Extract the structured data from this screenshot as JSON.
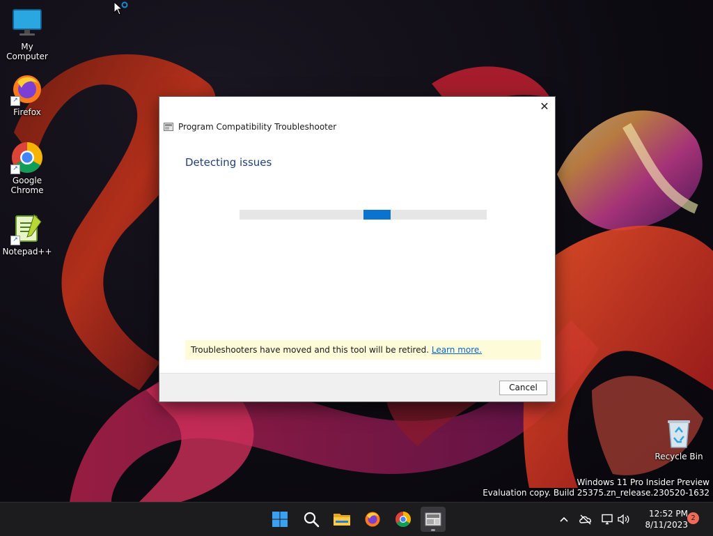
{
  "desktop": {
    "icons": [
      {
        "label": "My Computer",
        "icon": "monitor-icon"
      },
      {
        "label": "Firefox",
        "icon": "firefox-icon"
      },
      {
        "label": "Google Chrome",
        "icon": "chrome-icon"
      },
      {
        "label": "Notepad++",
        "icon": "notepadpp-icon"
      },
      {
        "label": "Recycle Bin",
        "icon": "recycle-bin-icon"
      }
    ],
    "watermark_line1": "Windows 11 Pro Insider Preview",
    "watermark_line2": "Evaluation copy. Build 25375.zn_release.230520-1632"
  },
  "dialog": {
    "title": "Program Compatibility Troubleshooter",
    "heading": "Detecting issues",
    "progress_state": "indeterminate",
    "notice_text": "Troubleshooters have moved and this tool will be retired.",
    "notice_link": "Learn more.",
    "cancel_label": "Cancel",
    "close_glyph": "✕",
    "notice_color": "#fefbd8",
    "accent_color": "#0a73d0"
  },
  "taskbar": {
    "pinned": [
      {
        "name": "start",
        "icon": "windows-start-icon"
      },
      {
        "name": "search",
        "icon": "search-icon"
      },
      {
        "name": "file-explorer",
        "icon": "folder-icon"
      },
      {
        "name": "firefox",
        "icon": "firefox-icon"
      },
      {
        "name": "chrome",
        "icon": "chrome-icon"
      },
      {
        "name": "troubleshooter",
        "icon": "troubleshooter-icon",
        "active": true
      }
    ],
    "tray": {
      "chevron": "^",
      "time": "12:52 PM",
      "date": "8/11/2023",
      "notifications": "2"
    }
  }
}
